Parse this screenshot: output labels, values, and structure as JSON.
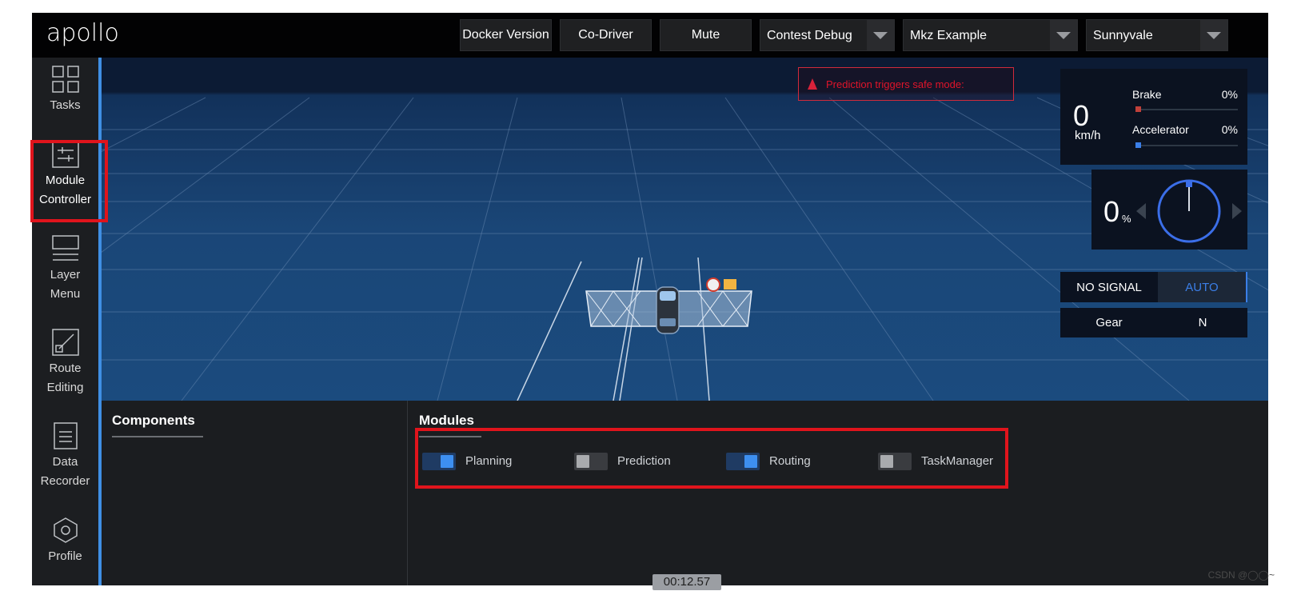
{
  "app": {
    "logo": "apollo"
  },
  "header": {
    "buttons": [
      "Docker Version",
      "Co-Driver",
      "Mute"
    ],
    "selects": [
      {
        "value": "Contest Debug"
      },
      {
        "value": "Mkz Example"
      },
      {
        "value": "Sunnyvale"
      }
    ]
  },
  "sidebar": {
    "items": [
      {
        "line1": "Tasks",
        "line2": "",
        "icon": "grid-icon"
      },
      {
        "line1": "Module",
        "line2": "Controller",
        "icon": "sliders-icon",
        "active": true
      },
      {
        "line1": "Layer",
        "line2": "Menu",
        "icon": "menu-icon"
      },
      {
        "line1": "Route",
        "line2": "Editing",
        "icon": "route-icon"
      },
      {
        "line1": "Data",
        "line2": "Recorder",
        "icon": "document-icon"
      },
      {
        "line1": "Profile",
        "line2": "",
        "icon": "hexagon-icon"
      }
    ]
  },
  "scene": {
    "alert": "Prediction triggers safe mode:",
    "alert_color": "#e0142a"
  },
  "dashboard": {
    "speed": "0",
    "speed_unit": "km/h",
    "brake_label": "Brake",
    "brake_value": "0%",
    "accelerator_label": "Accelerator",
    "accelerator_value": "0%",
    "steering_value": "0",
    "steering_unit": "%",
    "signal": "NO SIGNAL",
    "mode": "AUTO",
    "gear_label": "Gear",
    "gear_value": "N"
  },
  "components": {
    "title": "Components"
  },
  "modules": {
    "title": "Modules",
    "items": [
      {
        "label": "Planning",
        "on": true
      },
      {
        "label": "Prediction",
        "on": false
      },
      {
        "label": "Routing",
        "on": true
      },
      {
        "label": "TaskManager",
        "on": false
      }
    ]
  },
  "timer": "00:12.57",
  "watermark": "CSDN @◯◯~",
  "colors": {
    "accent": "#3f8fe4",
    "highlight": "#e0141c"
  }
}
